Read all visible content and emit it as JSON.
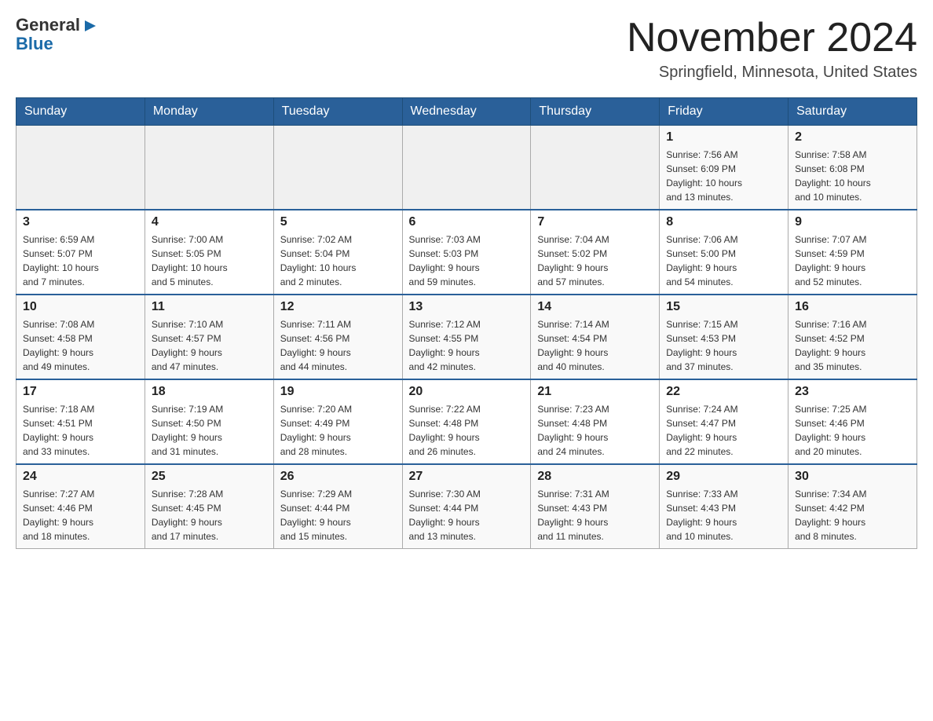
{
  "header": {
    "logo_general": "General",
    "logo_blue": "Blue",
    "month_title": "November 2024",
    "location": "Springfield, Minnesota, United States"
  },
  "weekdays": [
    "Sunday",
    "Monday",
    "Tuesday",
    "Wednesday",
    "Thursday",
    "Friday",
    "Saturday"
  ],
  "weeks": [
    {
      "days": [
        {
          "number": "",
          "info": ""
        },
        {
          "number": "",
          "info": ""
        },
        {
          "number": "",
          "info": ""
        },
        {
          "number": "",
          "info": ""
        },
        {
          "number": "",
          "info": ""
        },
        {
          "number": "1",
          "info": "Sunrise: 7:56 AM\nSunset: 6:09 PM\nDaylight: 10 hours\nand 13 minutes."
        },
        {
          "number": "2",
          "info": "Sunrise: 7:58 AM\nSunset: 6:08 PM\nDaylight: 10 hours\nand 10 minutes."
        }
      ]
    },
    {
      "days": [
        {
          "number": "3",
          "info": "Sunrise: 6:59 AM\nSunset: 5:07 PM\nDaylight: 10 hours\nand 7 minutes."
        },
        {
          "number": "4",
          "info": "Sunrise: 7:00 AM\nSunset: 5:05 PM\nDaylight: 10 hours\nand 5 minutes."
        },
        {
          "number": "5",
          "info": "Sunrise: 7:02 AM\nSunset: 5:04 PM\nDaylight: 10 hours\nand 2 minutes."
        },
        {
          "number": "6",
          "info": "Sunrise: 7:03 AM\nSunset: 5:03 PM\nDaylight: 9 hours\nand 59 minutes."
        },
        {
          "number": "7",
          "info": "Sunrise: 7:04 AM\nSunset: 5:02 PM\nDaylight: 9 hours\nand 57 minutes."
        },
        {
          "number": "8",
          "info": "Sunrise: 7:06 AM\nSunset: 5:00 PM\nDaylight: 9 hours\nand 54 minutes."
        },
        {
          "number": "9",
          "info": "Sunrise: 7:07 AM\nSunset: 4:59 PM\nDaylight: 9 hours\nand 52 minutes."
        }
      ]
    },
    {
      "days": [
        {
          "number": "10",
          "info": "Sunrise: 7:08 AM\nSunset: 4:58 PM\nDaylight: 9 hours\nand 49 minutes."
        },
        {
          "number": "11",
          "info": "Sunrise: 7:10 AM\nSunset: 4:57 PM\nDaylight: 9 hours\nand 47 minutes."
        },
        {
          "number": "12",
          "info": "Sunrise: 7:11 AM\nSunset: 4:56 PM\nDaylight: 9 hours\nand 44 minutes."
        },
        {
          "number": "13",
          "info": "Sunrise: 7:12 AM\nSunset: 4:55 PM\nDaylight: 9 hours\nand 42 minutes."
        },
        {
          "number": "14",
          "info": "Sunrise: 7:14 AM\nSunset: 4:54 PM\nDaylight: 9 hours\nand 40 minutes."
        },
        {
          "number": "15",
          "info": "Sunrise: 7:15 AM\nSunset: 4:53 PM\nDaylight: 9 hours\nand 37 minutes."
        },
        {
          "number": "16",
          "info": "Sunrise: 7:16 AM\nSunset: 4:52 PM\nDaylight: 9 hours\nand 35 minutes."
        }
      ]
    },
    {
      "days": [
        {
          "number": "17",
          "info": "Sunrise: 7:18 AM\nSunset: 4:51 PM\nDaylight: 9 hours\nand 33 minutes."
        },
        {
          "number": "18",
          "info": "Sunrise: 7:19 AM\nSunset: 4:50 PM\nDaylight: 9 hours\nand 31 minutes."
        },
        {
          "number": "19",
          "info": "Sunrise: 7:20 AM\nSunset: 4:49 PM\nDaylight: 9 hours\nand 28 minutes."
        },
        {
          "number": "20",
          "info": "Sunrise: 7:22 AM\nSunset: 4:48 PM\nDaylight: 9 hours\nand 26 minutes."
        },
        {
          "number": "21",
          "info": "Sunrise: 7:23 AM\nSunset: 4:48 PM\nDaylight: 9 hours\nand 24 minutes."
        },
        {
          "number": "22",
          "info": "Sunrise: 7:24 AM\nSunset: 4:47 PM\nDaylight: 9 hours\nand 22 minutes."
        },
        {
          "number": "23",
          "info": "Sunrise: 7:25 AM\nSunset: 4:46 PM\nDaylight: 9 hours\nand 20 minutes."
        }
      ]
    },
    {
      "days": [
        {
          "number": "24",
          "info": "Sunrise: 7:27 AM\nSunset: 4:46 PM\nDaylight: 9 hours\nand 18 minutes."
        },
        {
          "number": "25",
          "info": "Sunrise: 7:28 AM\nSunset: 4:45 PM\nDaylight: 9 hours\nand 17 minutes."
        },
        {
          "number": "26",
          "info": "Sunrise: 7:29 AM\nSunset: 4:44 PM\nDaylight: 9 hours\nand 15 minutes."
        },
        {
          "number": "27",
          "info": "Sunrise: 7:30 AM\nSunset: 4:44 PM\nDaylight: 9 hours\nand 13 minutes."
        },
        {
          "number": "28",
          "info": "Sunrise: 7:31 AM\nSunset: 4:43 PM\nDaylight: 9 hours\nand 11 minutes."
        },
        {
          "number": "29",
          "info": "Sunrise: 7:33 AM\nSunset: 4:43 PM\nDaylight: 9 hours\nand 10 minutes."
        },
        {
          "number": "30",
          "info": "Sunrise: 7:34 AM\nSunset: 4:42 PM\nDaylight: 9 hours\nand 8 minutes."
        }
      ]
    }
  ]
}
